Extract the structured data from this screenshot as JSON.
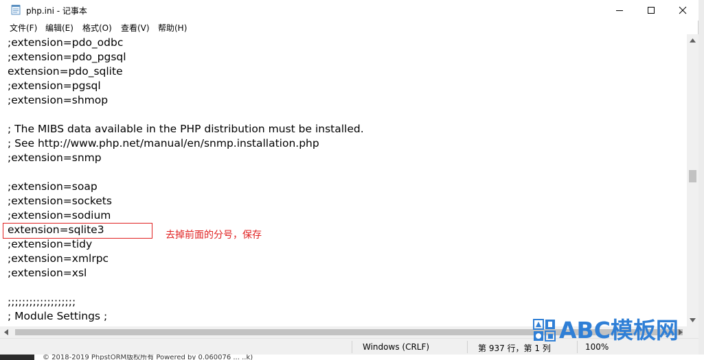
{
  "window": {
    "title": "php.ini - 记事本",
    "menu": [
      "文件(F)",
      "编辑(E)",
      "格式(O)",
      "查看(V)",
      "帮助(H)"
    ]
  },
  "editor": {
    "lines": [
      ";extension=pdo_odbc",
      ";extension=pdo_pgsql",
      "extension=pdo_sqlite",
      ";extension=pgsql",
      ";extension=shmop",
      "",
      "; The MIBS data available in the PHP distribution must be installed.",
      "; See http://www.php.net/manual/en/snmp.installation.php",
      ";extension=snmp",
      "",
      ";extension=soap",
      ";extension=sockets",
      ";extension=sodium",
      "extension=sqlite3",
      ";extension=tidy",
      ";extension=xmlrpc",
      ";extension=xsl",
      "",
      ";;;;;;;;;;;;;;;;;;;",
      "; Module Settings ;"
    ],
    "annotation": "去掉前面的分号，保存"
  },
  "statusbar": {
    "line_ending": "Windows (CRLF)",
    "position": "第 937 行，第 1 列",
    "zoom": "100%"
  },
  "background": {
    "footer_text": "© 2018-2019 PhpstORM版权所有  Powered by 0.060076  ...  ..k)"
  },
  "watermark": {
    "text": "ABC模板网"
  },
  "colors": {
    "annotation_red": "#e02020",
    "watermark_blue": "#2f7fd6"
  },
  "icons": {
    "app": "notepad-icon",
    "minimize": "minimize-icon",
    "maximize": "maximize-icon",
    "close": "close-icon"
  }
}
